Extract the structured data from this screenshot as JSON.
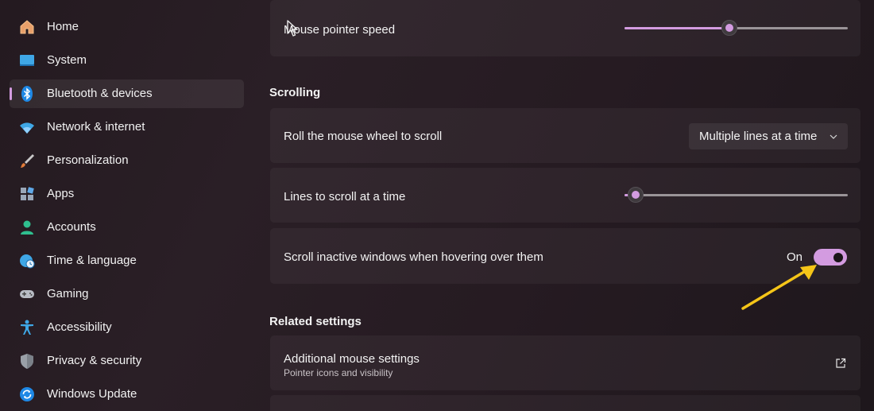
{
  "sidebar": {
    "selected_accent": "#d39be0",
    "items": [
      {
        "label": "Home",
        "icon": "home-icon"
      },
      {
        "label": "System",
        "icon": "system-display-icon"
      },
      {
        "label": "Bluetooth & devices",
        "icon": "bluetooth-icon",
        "selected": true
      },
      {
        "label": "Network & internet",
        "icon": "wifi-icon"
      },
      {
        "label": "Personalization",
        "icon": "paintbrush-icon"
      },
      {
        "label": "Apps",
        "icon": "apps-icon"
      },
      {
        "label": "Accounts",
        "icon": "account-icon"
      },
      {
        "label": "Time & language",
        "icon": "globe-clock-icon"
      },
      {
        "label": "Gaming",
        "icon": "gamepad-icon"
      },
      {
        "label": "Accessibility",
        "icon": "accessibility-icon"
      },
      {
        "label": "Privacy & security",
        "icon": "shield-icon"
      },
      {
        "label": "Windows Update",
        "icon": "update-icon"
      }
    ]
  },
  "main": {
    "pointer_speed": {
      "label": "Mouse pointer speed",
      "icon": "mouse-pointer-icon",
      "value_fraction": 0.47
    },
    "scrolling": {
      "title": "Scrolling",
      "wheel": {
        "label": "Roll the mouse wheel to scroll",
        "selected_option": "Multiple lines at a time"
      },
      "lines": {
        "label": "Lines to scroll at a time",
        "value_fraction": 0.05
      },
      "inactive": {
        "label": "Scroll inactive windows when hovering over them",
        "state_label": "On",
        "on": true
      }
    },
    "related": {
      "title": "Related settings",
      "additional_mouse": {
        "label": "Additional mouse settings",
        "sublabel": "Pointer icons and visibility",
        "icon": "open-external-icon"
      }
    }
  },
  "annotation": {
    "arrow_color": "#f5c518"
  }
}
